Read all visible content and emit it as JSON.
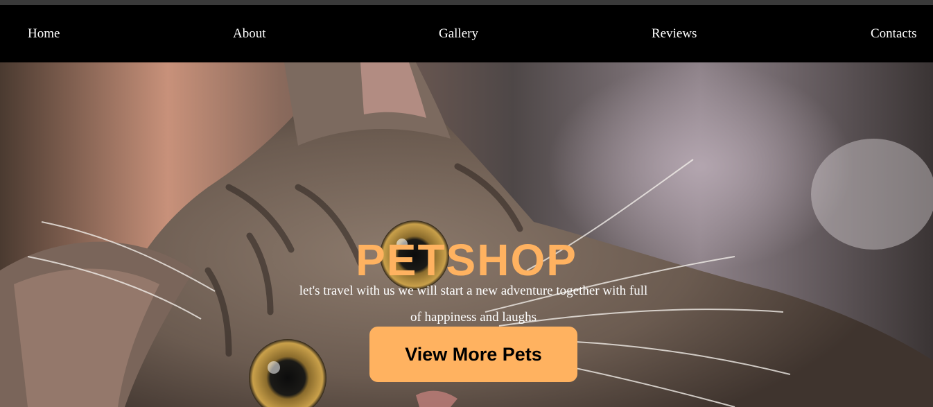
{
  "nav": {
    "items": [
      {
        "label": "Home"
      },
      {
        "label": "About"
      },
      {
        "label": "Gallery"
      },
      {
        "label": "Reviews"
      },
      {
        "label": "Contacts"
      }
    ]
  },
  "hero": {
    "title": "PETSHOP",
    "subtitle": "let's travel with us we will start a new adventure together with full of happiness and laughs",
    "button_label": "View More Pets",
    "background_image": "tabby-cat-photo"
  },
  "colors": {
    "accent": "#ffb260",
    "nav_bg": "#000000",
    "text_light": "#ffffff"
  }
}
